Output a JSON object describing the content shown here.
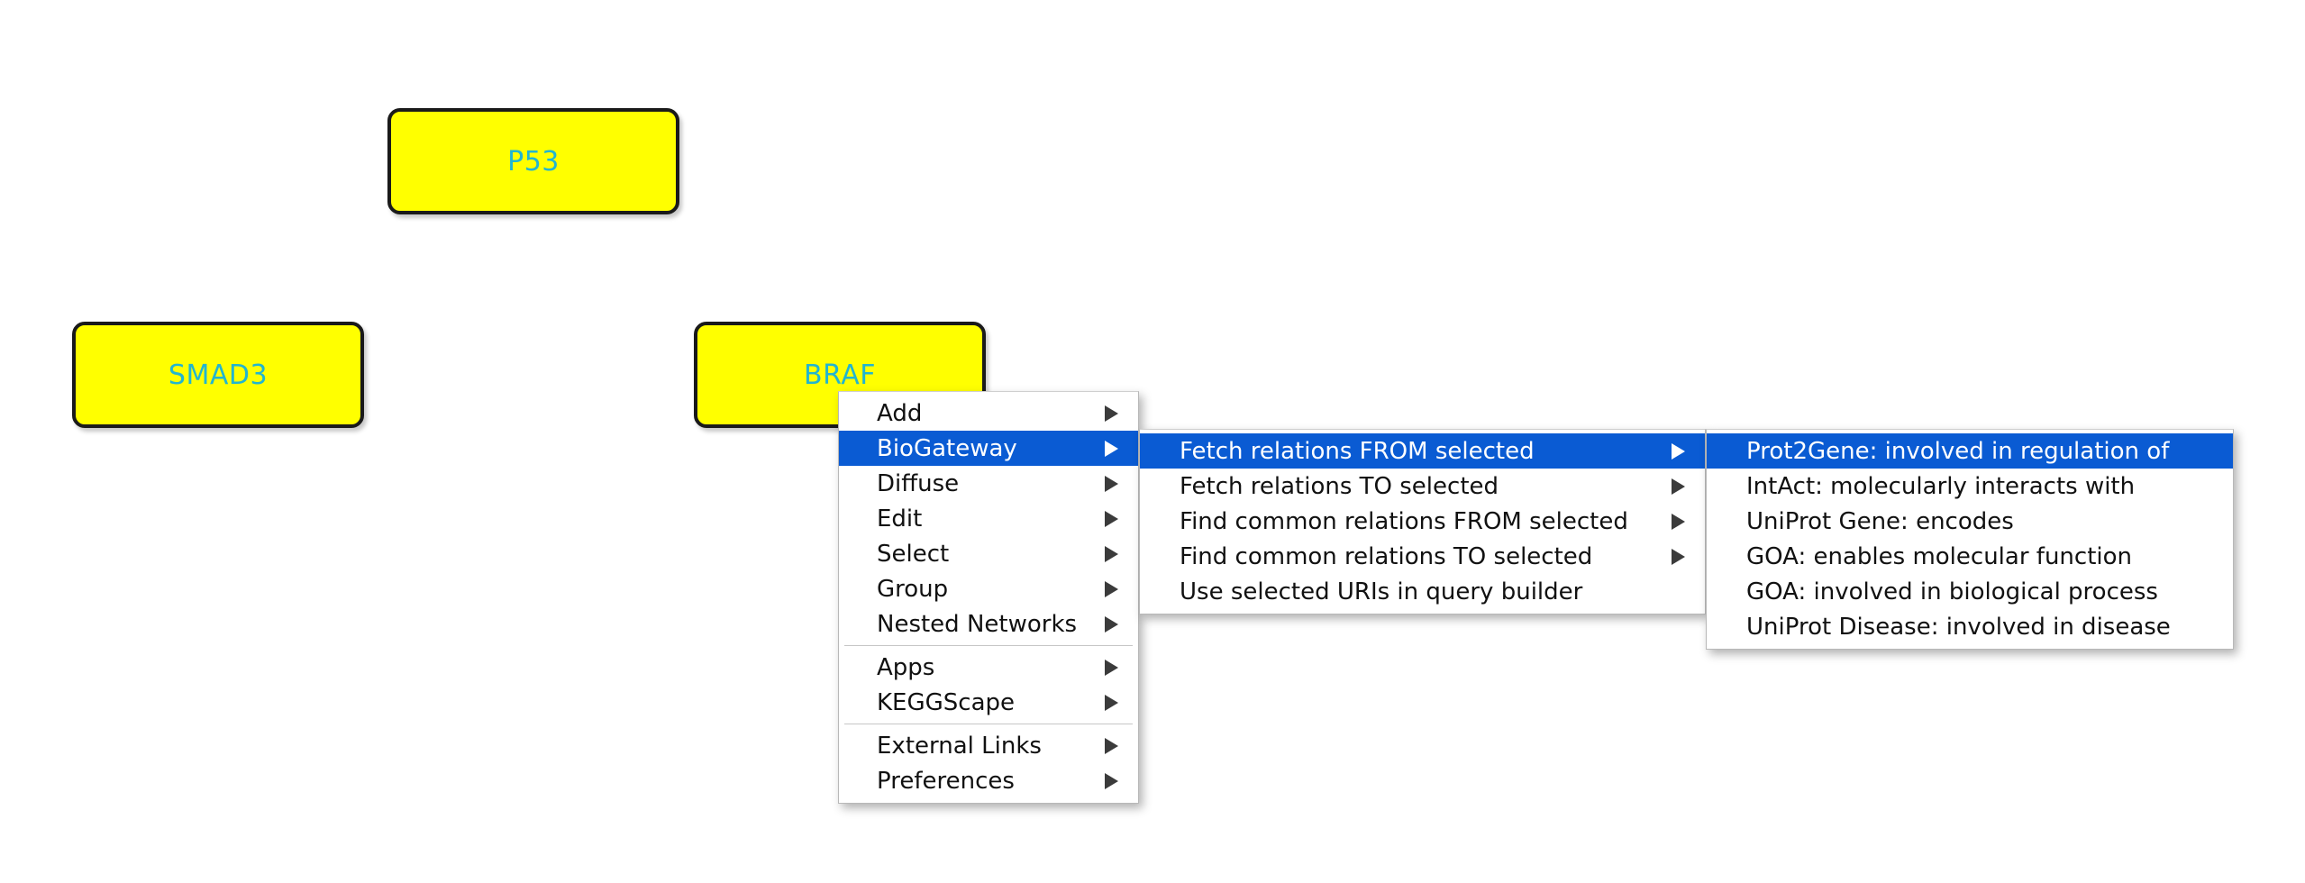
{
  "network": {
    "nodes": [
      {
        "label": "P53",
        "fill": "#ffff00",
        "text_color": "#22b5d0",
        "border_color": "#1a1a1a"
      },
      {
        "label": "SMAD3",
        "fill": "#ffff00",
        "text_color": "#22b5d0",
        "border_color": "#1a1a1a"
      },
      {
        "label": "BRAF",
        "fill": "#ffff00",
        "text_color": "#22b5d0",
        "border_color": "#1a1a1a"
      }
    ]
  },
  "context_menu": {
    "highlight_color": "#0a5bd3",
    "highlight_text_color": "#ffffff",
    "background": "#ffffff",
    "items": [
      {
        "label": "Add",
        "submenu": true,
        "selected": false
      },
      {
        "label": "BioGateway",
        "submenu": true,
        "selected": true
      },
      {
        "label": "Diffuse",
        "submenu": true,
        "selected": false
      },
      {
        "label": "Edit",
        "submenu": true,
        "selected": false
      },
      {
        "label": "Select",
        "submenu": true,
        "selected": false
      },
      {
        "label": "Group",
        "submenu": true,
        "selected": false
      },
      {
        "label": "Nested Networks",
        "submenu": true,
        "selected": false
      },
      {
        "label": "Apps",
        "submenu": true,
        "selected": false
      },
      {
        "label": "KEGGScape",
        "submenu": true,
        "selected": false
      },
      {
        "label": "External Links",
        "submenu": true,
        "selected": false
      },
      {
        "label": "Preferences",
        "submenu": true,
        "selected": false
      }
    ]
  },
  "biogateway_submenu": {
    "items": [
      {
        "label": "Fetch relations FROM selected",
        "submenu": true,
        "selected": true
      },
      {
        "label": "Fetch relations TO selected",
        "submenu": true,
        "selected": false
      },
      {
        "label": "Find common relations FROM selected",
        "submenu": true,
        "selected": false
      },
      {
        "label": "Find common relations TO selected",
        "submenu": true,
        "selected": false
      },
      {
        "label": "Use selected URIs in query builder",
        "submenu": false,
        "selected": false
      }
    ]
  },
  "fetch_relations_submenu": {
    "items": [
      {
        "label": "Prot2Gene: involved in regulation of",
        "submenu": false,
        "selected": true
      },
      {
        "label": "IntAct: molecularly interacts with",
        "submenu": false,
        "selected": false
      },
      {
        "label": "UniProt Gene: encodes",
        "submenu": false,
        "selected": false
      },
      {
        "label": "GOA: enables molecular function",
        "submenu": false,
        "selected": false
      },
      {
        "label": "GOA: involved in biological process",
        "submenu": false,
        "selected": false
      },
      {
        "label": "UniProt Disease: involved in disease",
        "submenu": false,
        "selected": false
      }
    ]
  }
}
